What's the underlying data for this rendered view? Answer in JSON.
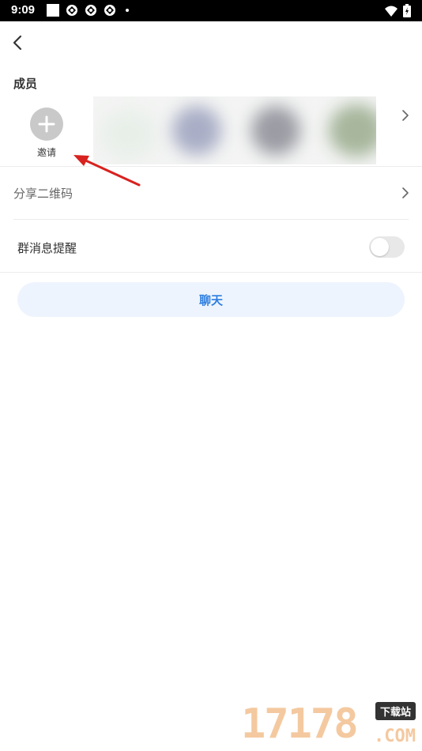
{
  "status_bar": {
    "time": "9:09"
  },
  "members": {
    "section_title": "成员",
    "invite_label": "邀请"
  },
  "share_qr": {
    "label": "分享二维码"
  },
  "notify": {
    "label": "群消息提醒",
    "enabled": false
  },
  "chat_button": {
    "label": "聊天"
  },
  "colors": {
    "accent": "#2f7fe0",
    "button_bg": "#eef4fd",
    "arrow": "#d8221f"
  },
  "watermark": {
    "digits": "17178",
    "badge": "下载站",
    "suffix": ".COM"
  }
}
